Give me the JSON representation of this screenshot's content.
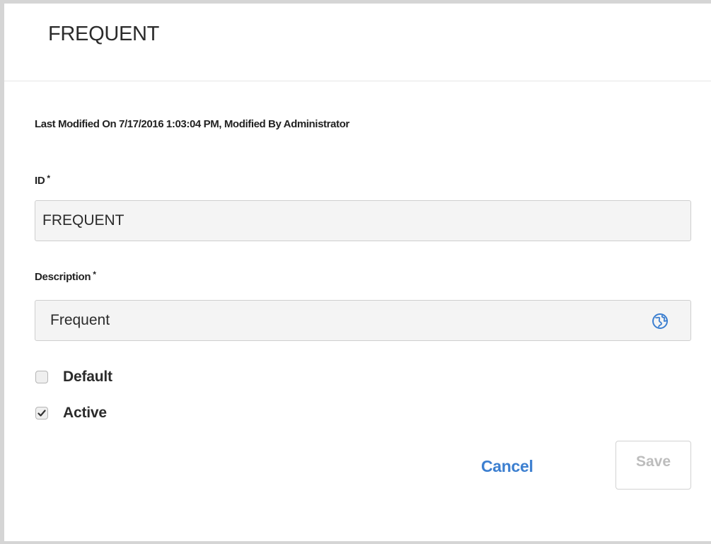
{
  "dialog": {
    "title": "FREQUENT",
    "modified_text": "Last Modified On 7/17/2016 1:03:04 PM, Modified By Administrator"
  },
  "fields": {
    "id": {
      "label": "ID",
      "required_mark": "*",
      "value": "FREQUENT"
    },
    "description": {
      "label": "Description",
      "required_mark": "*",
      "value": "Frequent",
      "icon": "globe-icon"
    }
  },
  "checkboxes": {
    "default": {
      "label": "Default",
      "checked": false
    },
    "active": {
      "label": "Active",
      "checked": true
    }
  },
  "buttons": {
    "cancel_label": "Cancel",
    "save_label": "Save"
  },
  "colors": {
    "accent": "#3c7fd0",
    "disabled_text": "#bdbdbd",
    "border": "#d5d5d5"
  }
}
